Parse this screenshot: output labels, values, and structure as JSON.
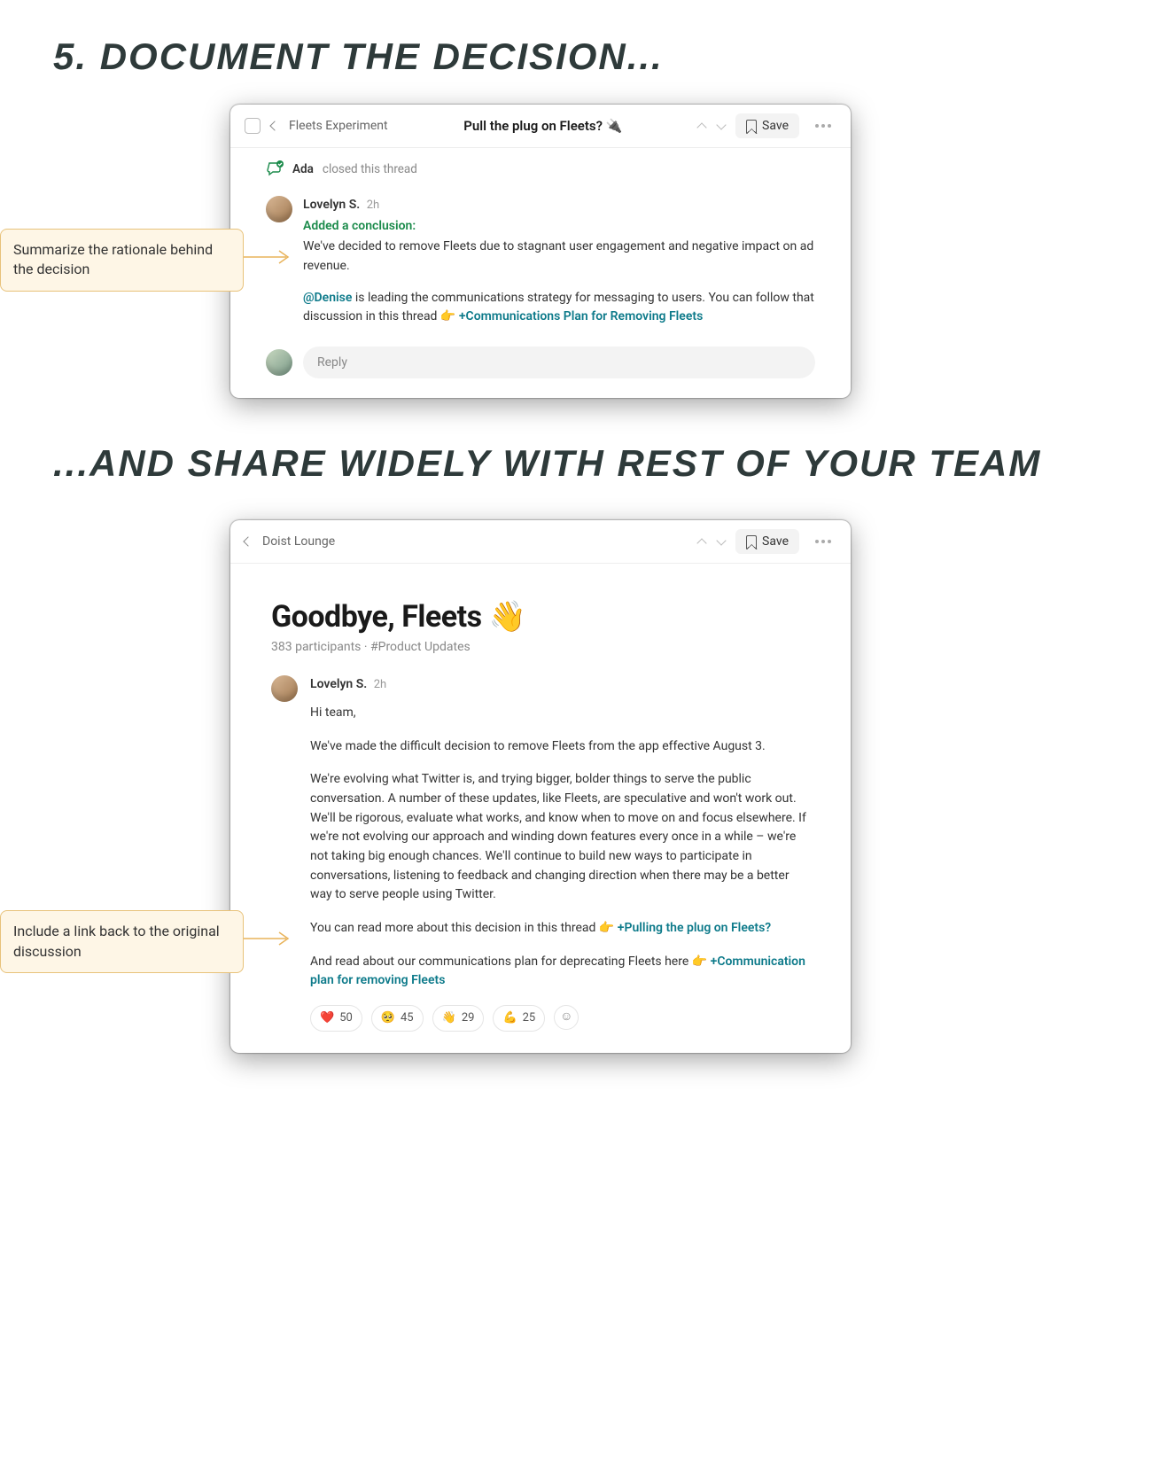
{
  "heading1": "5. Document the decision...",
  "heading2": "...and share widely with rest of your team",
  "callout1": "Summarize the rationale behind the decision",
  "callout2": "Include a link back to the original discussion",
  "card1": {
    "breadcrumb": "Fleets Experiment",
    "title": "Pull the plug on Fleets? 🔌",
    "save_label": "Save",
    "closed_by": "Ada",
    "closed_text": "closed this thread",
    "author": "Lovelyn S.",
    "time": "2h",
    "conclusion_label": "Added a conclusion:",
    "para1": "We've decided to remove Fleets due to stagnant user engagement and negative impact on ad revenue.",
    "mention": "@Denise",
    "para2a": " is leading the communications strategy for messaging to users. You can follow that discussion in this thread 👉 ",
    "link2": "+Communications Plan for Removing Fleets",
    "reply_placeholder": "Reply"
  },
  "card2": {
    "breadcrumb": "Doist Lounge",
    "save_label": "Save",
    "title": "Goodbye, Fleets 👋",
    "participants": "383 participants",
    "channel": "#Product Updates",
    "author": "Lovelyn S.",
    "time": "2h",
    "p1": "Hi team,",
    "p2": "We've made the difficult decision to remove Fleets from the app effective August 3.",
    "p3": "We're evolving what Twitter is, and trying bigger, bolder things to serve the public conversation. A number of these updates, like Fleets, are speculative and won't work out. We'll be rigorous, evaluate what works, and know when to move on and focus elsewhere. If we're not evolving our approach and winding down features every once in a while – we're not taking big enough chances. We'll continue to build new ways to participate in conversations, listening to feedback and changing direction when there may be a better way to serve people using Twitter.",
    "p4a": "You can read more about this decision in this thread 👉 ",
    "link4": "+Pulling the plug on Fleets?",
    "p5a": "And read about our communications plan for deprecating Fleets here 👉 ",
    "link5": "+Communication plan for removing Fleets",
    "reactions": [
      {
        "emoji": "❤️",
        "count": "50"
      },
      {
        "emoji": "🥺",
        "count": "45"
      },
      {
        "emoji": "👋",
        "count": "29"
      },
      {
        "emoji": "💪",
        "count": "25"
      }
    ]
  }
}
